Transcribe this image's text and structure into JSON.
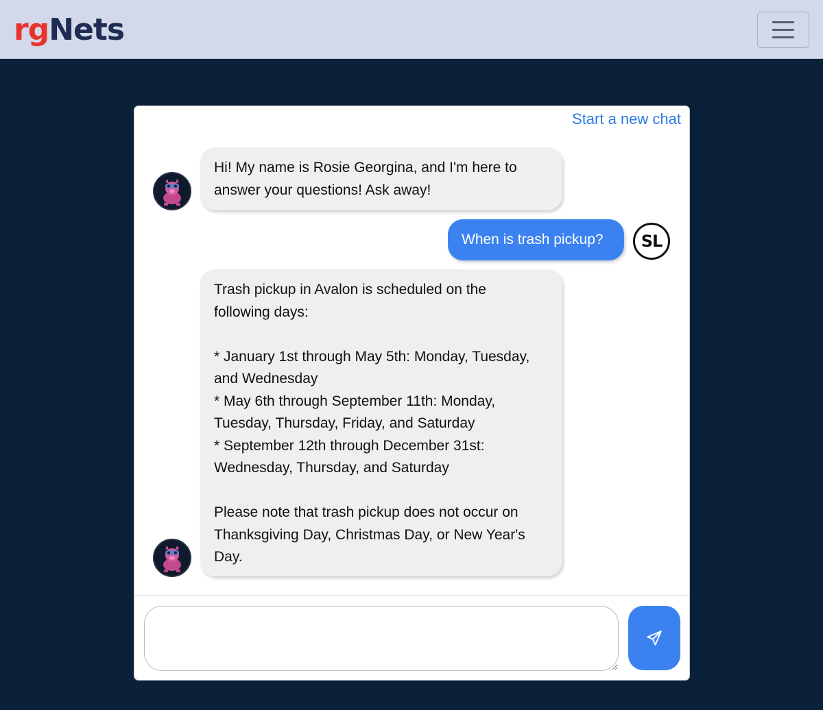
{
  "header": {
    "logo_part1": "rg",
    "logo_part2": "Nets",
    "menu_button_icon": "hamburger-menu-icon"
  },
  "chat": {
    "new_chat_link": "Start a new chat",
    "messages": [
      {
        "sender": "bot",
        "avatar_icon": "pig-robot-avatar-icon",
        "text": "Hi! My name is Rosie Georgina, and I'm here to\nanswer your questions! Ask away!"
      },
      {
        "sender": "user",
        "avatar_initials": "SL",
        "text": "When is trash pickup?"
      },
      {
        "sender": "bot",
        "avatar_icon": "pig-robot-avatar-icon",
        "text": "Trash pickup in Avalon is scheduled on the\nfollowing days:\n\n* January 1st through May 5th: Monday, Tuesday,\nand Wednesday\n* May 6th through September 11th: Monday,\nTuesday, Thursday, Friday, and Saturday\n* September 12th through December 31st:\nWednesday, Thursday, and Saturday\n\nPlease note that trash pickup does not occur on\nThanksgiving Day, Christmas Day, or New Year's\nDay."
      }
    ],
    "input": {
      "value": "",
      "placeholder": ""
    },
    "send_icon": "paper-plane-icon"
  },
  "colors": {
    "page_background": "#0b2039",
    "navbar_background": "#d3d8ea",
    "accent_blue": "#3b82f0",
    "bot_bubble": "#efefef",
    "logo_red": "#e8342b",
    "logo_navy": "#1d2c52"
  }
}
